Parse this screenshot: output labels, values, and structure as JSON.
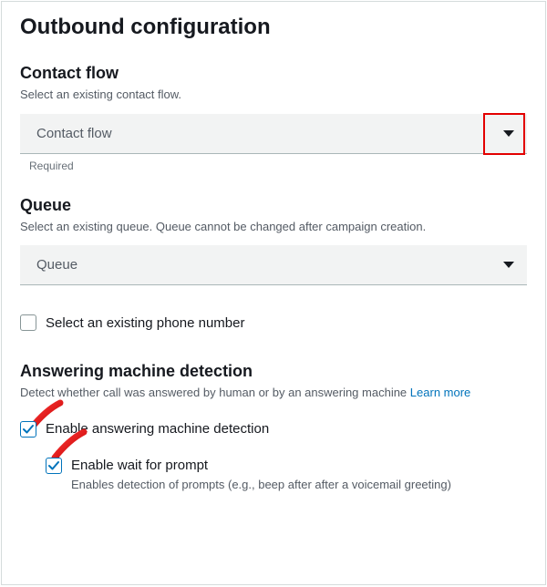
{
  "heading": "Outbound configuration",
  "contactFlow": {
    "title": "Contact flow",
    "desc": "Select an existing contact flow.",
    "placeholder": "Contact flow",
    "constraint": "Required"
  },
  "queue": {
    "title": "Queue",
    "desc": "Select an existing queue. Queue cannot be changed after campaign creation.",
    "placeholder": "Queue"
  },
  "phone": {
    "label": "Select an existing phone number",
    "checked": false
  },
  "amd": {
    "title": "Answering machine detection",
    "desc": "Detect whether call was answered by human or by an answering machine",
    "learnMore": "Learn more",
    "enable": {
      "label": "Enable answering machine detection",
      "checked": true
    },
    "waitForPrompt": {
      "label": "Enable wait for prompt",
      "sublabel": "Enables detection of prompts (e.g., beep after after a voicemail greeting)",
      "checked": true
    }
  }
}
